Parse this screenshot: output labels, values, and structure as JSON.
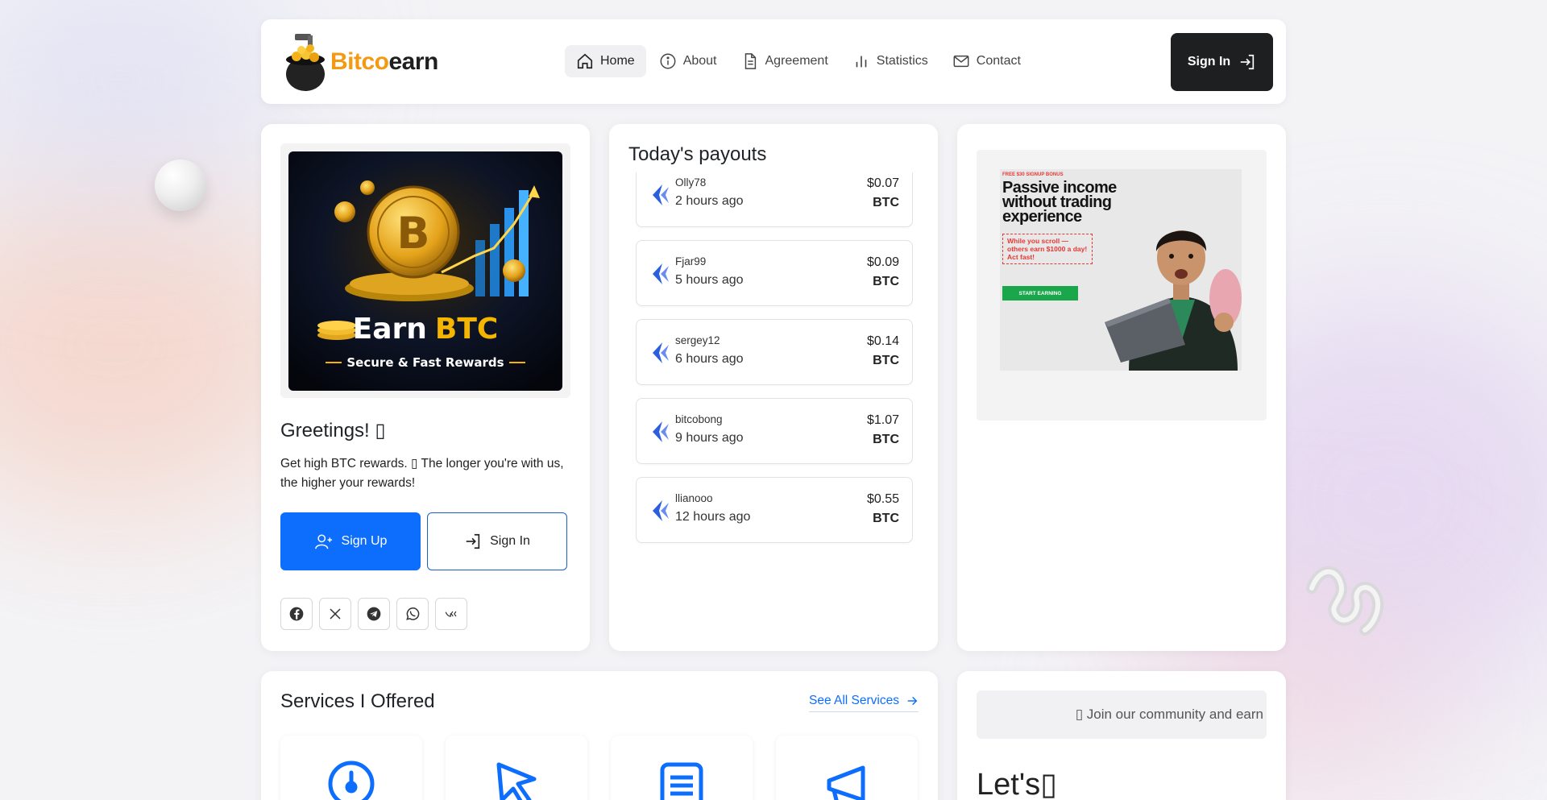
{
  "brand": {
    "part1": "Bitco",
    "part2": "earn"
  },
  "nav": [
    {
      "label": "Home",
      "icon": "home-icon",
      "active": true
    },
    {
      "label": "About",
      "icon": "info-icon"
    },
    {
      "label": "Agreement",
      "icon": "document-icon"
    },
    {
      "label": "Statistics",
      "icon": "bar-chart-icon"
    },
    {
      "label": "Contact",
      "icon": "mail-icon"
    }
  ],
  "header": {
    "signin_label": "Sign In"
  },
  "hero": {
    "banner_title_1": "Earn",
    "banner_title_2": "BTC",
    "banner_subtitle": "Secure & Fast Rewards",
    "greeting": "Greetings! ▯",
    "description": "Get high BTC rewards. ▯ The longer you're with us, the higher your rewards!",
    "signup_label": "Sign Up",
    "signin_label": "Sign In"
  },
  "socials": [
    "facebook-icon",
    "x-icon",
    "telegram-icon",
    "whatsapp-icon",
    "vk-icon"
  ],
  "payouts": {
    "title": "Today's payouts",
    "items": [
      {
        "user": "Olly78",
        "time": "2 hours ago",
        "amount": "$0.07",
        "currency": "BTC"
      },
      {
        "user": "Fjar99",
        "time": "5 hours ago",
        "amount": "$0.09",
        "currency": "BTC"
      },
      {
        "user": "sergey12",
        "time": "6 hours ago",
        "amount": "$0.14",
        "currency": "BTC"
      },
      {
        "user": "bitcobong",
        "time": "9 hours ago",
        "amount": "$1.07",
        "currency": "BTC"
      },
      {
        "user": "llianooo",
        "time": "12 hours ago",
        "amount": "$0.55",
        "currency": "BTC"
      }
    ]
  },
  "ad": {
    "bonus": "FREE $30 SIGNUP BONUS",
    "headline": "Passive income without trading experience",
    "note": "While you scroll — others earn $1000 a day! Act fast!",
    "cta": "START EARNING"
  },
  "services": {
    "title": "Services I Offered",
    "see_all": "See All Services",
    "items": [
      "clock-icon",
      "cursor-icon",
      "list-document-icon",
      "megaphone-icon"
    ]
  },
  "community": {
    "banner": "▯ Join our community and earn",
    "heading": "Let's▯"
  },
  "colors": {
    "accent": "#0d6efd",
    "brand_orange": "#f39a12",
    "dark_button": "#1e1f21"
  }
}
